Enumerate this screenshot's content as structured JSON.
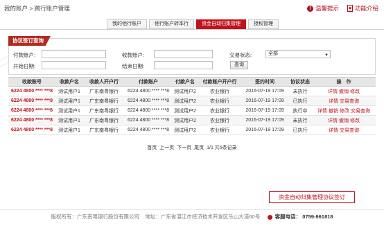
{
  "breadcrumb": "我的账户 > 跨行账户管理",
  "top_actions": [
    {
      "label": "温馨提示",
      "icon": "info-icon"
    },
    {
      "label": "功能介绍",
      "icon": "document-icon"
    }
  ],
  "tabs": [
    {
      "label": "我的他行账户",
      "active": false
    },
    {
      "label": "他行账户转本行",
      "active": false
    },
    {
      "label": "资金自动归集管理",
      "active": true
    },
    {
      "label": "授权管理",
      "active": false
    }
  ],
  "query_panel": {
    "title": "协议签订查询",
    "payer_label": "付款账户:",
    "payer_value": "",
    "payee_label": "收款账户:",
    "payee_value": "",
    "status_label": "交易状态:",
    "status_value": "全部",
    "start_label": "开始日期:",
    "start_value": "",
    "end_label": "结束日期:",
    "end_value": "",
    "query_button": "查询"
  },
  "table": {
    "headers": [
      "收款账号",
      "收款户名",
      "收款人开户行",
      "付款账户",
      "付款户名",
      "付款账户开户行",
      "签约时间",
      "协议状态",
      "操　作"
    ],
    "rows": [
      {
        "payee_acct": "6224 4800 **** ***8",
        "payee_name": "测试用户1",
        "payee_bank": "广东南粤银行",
        "payer_acct": "6224 4800 **** ***8",
        "payer_name": "测试用户2",
        "payer_bank": "农业银行",
        "sign_time": "2016-07-19 17:09",
        "status": "未执行",
        "ops": [
          "详情",
          "撤销",
          "修改"
        ]
      },
      {
        "payee_acct": "6224 4800 **** ***8",
        "payee_name": "测试用户1",
        "payee_bank": "广东南粤银行",
        "payer_acct": "6224 4800 **** ***8",
        "payer_name": "测试用户2",
        "payer_bank": "农业银行",
        "sign_time": "2016-07-19 17:09",
        "status": "已执行",
        "ops": [
          "详情",
          "交易查询"
        ]
      },
      {
        "payee_acct": "6224 4800 **** ***8",
        "payee_name": "测试用户1",
        "payee_bank": "广东南粤银行",
        "payer_acct": "6224 4800 **** ***8",
        "payer_name": "测试用户2",
        "payer_bank": "农业银行",
        "sign_time": "2016-07-19 17:09",
        "status": "执行中",
        "ops": [
          "详情",
          "撤销",
          "修改",
          "交易查询"
        ]
      },
      {
        "payee_acct": "6224 4800 **** ***8",
        "payee_name": "测试用户1",
        "payee_bank": "广东南粤银行",
        "payer_acct": "6224 4800 **** ***8",
        "payer_name": "测试用户2",
        "payer_bank": "农业银行",
        "sign_time": "2016-07-19 17:09",
        "status": "未执行",
        "ops": [
          "详情",
          "撤销",
          "修改"
        ]
      },
      {
        "payee_acct": "6224 4800 **** ***8",
        "payee_name": "测试用户1",
        "payee_bank": "广东南粤银行",
        "payer_acct": "6224 4800 **** ***8",
        "payer_name": "测试用户2",
        "payer_bank": "农业银行",
        "sign_time": "2016-07-19 17:09",
        "status": "已执行",
        "ops": [
          "详情",
          "交易查询"
        ]
      }
    ]
  },
  "pager": {
    "first": "首页",
    "prev": "上一页",
    "next": "下一页",
    "last": "尾页",
    "info": "1/1 共5条记录"
  },
  "bottom_button": "资金自动归集管理协议签订",
  "footer": {
    "copyright": "版权所有：广东南粤银行股份有限公司",
    "address": "地址：广东省湛江市经济技术开发区乐山大道60号",
    "tel_label": "客服电话：",
    "tel": "0759-961818"
  },
  "colors": {
    "accent": "#c0141d",
    "header_bg": "#e6e6e6"
  }
}
